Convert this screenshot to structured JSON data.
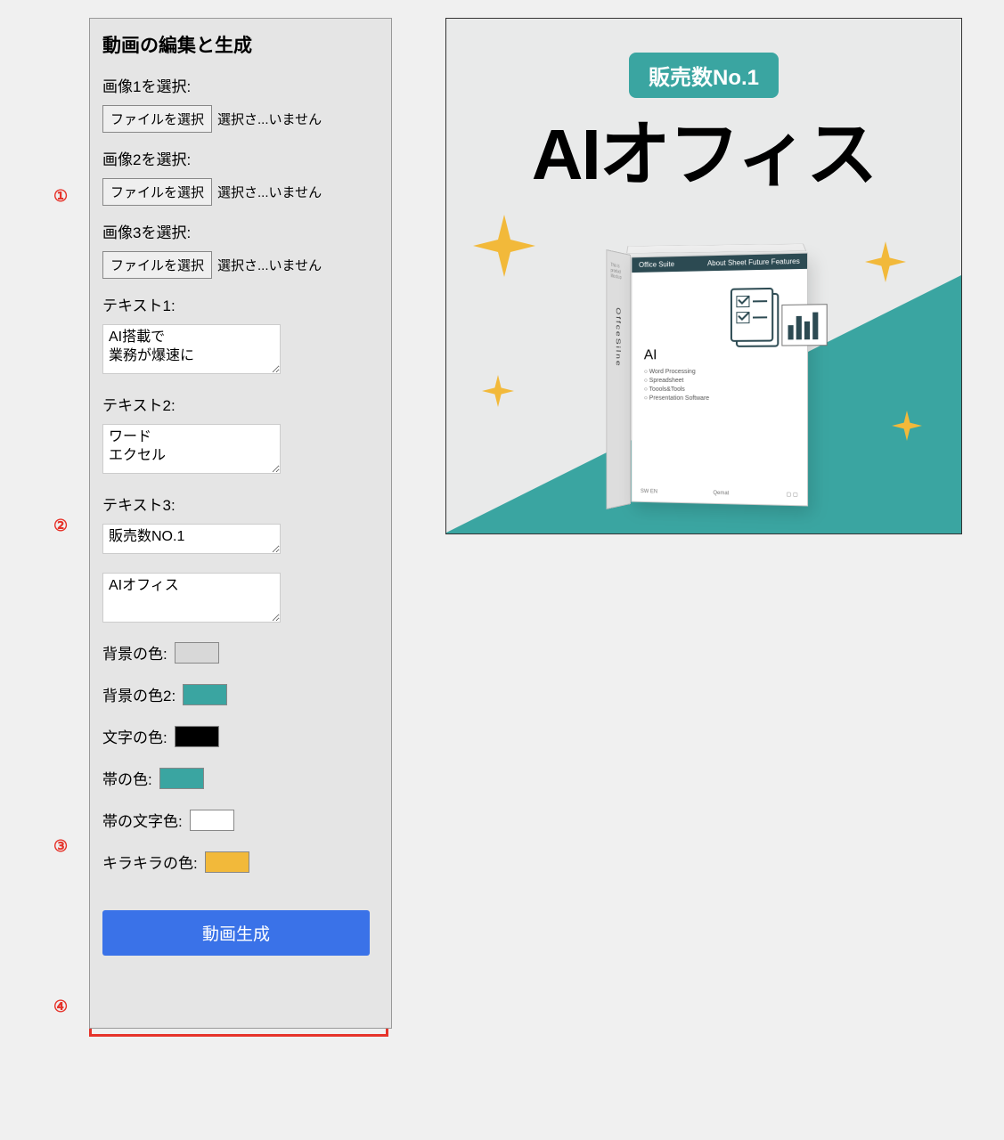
{
  "panel": {
    "title": "動画の編集と生成",
    "image_fields": [
      {
        "label": "画像1を選択:",
        "button": "ファイルを選択",
        "status": "選択さ...いません"
      },
      {
        "label": "画像2を選択:",
        "button": "ファイルを選択",
        "status": "選択さ...いません"
      },
      {
        "label": "画像3を選択:",
        "button": "ファイルを選択",
        "status": "選択さ...いません"
      }
    ],
    "text_fields": [
      {
        "label": "テキスト1:",
        "value": "AI搭載で\n業務が爆速に"
      },
      {
        "label": "テキスト2:",
        "value": "ワード\nエクセル"
      },
      {
        "label": "テキスト3:",
        "value": "販売数NO.1"
      },
      {
        "label": "",
        "value": "AIオフィス"
      }
    ],
    "color_fields": [
      {
        "label": "背景の色:",
        "value": "#d8d8d8"
      },
      {
        "label": "背景の色2:",
        "value": "#3aa5a1"
      },
      {
        "label": "文字の色:",
        "value": "#000000"
      },
      {
        "label": "帯の色:",
        "value": "#3aa5a1"
      },
      {
        "label": "帯の文字色:",
        "value": "#ffffff"
      },
      {
        "label": "キラキラの色:",
        "value": "#f2b93a"
      }
    ],
    "generate_button": "動画生成"
  },
  "section_numbers": [
    "①",
    "②",
    "③",
    "④"
  ],
  "preview": {
    "badge": "販売数No.1",
    "title": "AIオフィス",
    "box_header": "Office Suite",
    "box_header_items": "About   Sheet   Future   Features",
    "box_side_text": "OffceSilne",
    "box_side_tiny": "This is product\nMockup",
    "box_ai_label": "AI",
    "box_features": [
      "○ Word Processing",
      "○ Spreadsheet",
      "○ Toools&Tools",
      "○ Presentation Software"
    ],
    "box_footer_left": "SW  EN",
    "box_footer_mid": "Qemat",
    "colors": {
      "bg": "#e9eaea",
      "accent": "#3aa5a1",
      "sparkle": "#f2b93a",
      "text": "#111111"
    }
  }
}
